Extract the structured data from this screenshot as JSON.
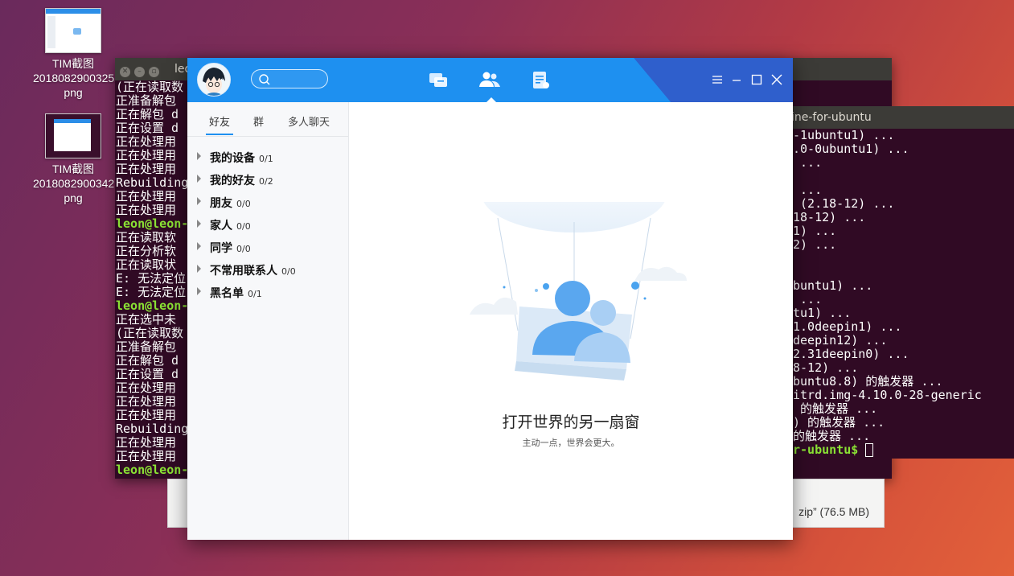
{
  "desktop": {
    "icons": [
      {
        "name": "TIM截图",
        "file": "20180829003252",
        "ext": "png"
      },
      {
        "name": "TIM截图",
        "file": "20180829003429",
        "ext": "png"
      }
    ]
  },
  "terminal_back": {
    "title": "leo",
    "lines": [
      {
        "t": "(正在读取数",
        "p": false
      },
      {
        "t": "正准备解包",
        "p": false
      },
      {
        "t": "正在解包 d",
        "p": false
      },
      {
        "t": "正在设置 d",
        "p": false
      },
      {
        "t": "正在处理用",
        "p": false
      },
      {
        "t": "正在处理用",
        "p": false
      },
      {
        "t": "正在处理用",
        "p": false
      },
      {
        "t": "Rebuilding",
        "p": false
      },
      {
        "t": "正在处理用",
        "p": false
      },
      {
        "t": "正在处理用",
        "p": false
      },
      {
        "t": "leon@leon-",
        "p": true
      },
      {
        "t": "正在读取软",
        "p": false
      },
      {
        "t": "正在分析软",
        "p": false
      },
      {
        "t": "正在读取状",
        "p": false
      },
      {
        "t": "E: 无法定位",
        "p": false
      },
      {
        "t": "E: 无法定位",
        "p": false
      },
      {
        "t": "leon@leon-",
        "p": true
      },
      {
        "t": "正在选中未",
        "p": false
      },
      {
        "t": "(正在读取数",
        "p": false
      },
      {
        "t": "正准备解包",
        "p": false
      },
      {
        "t": "正在解包 d",
        "p": false
      },
      {
        "t": "正在设置 d",
        "p": false
      },
      {
        "t": "正在处理用",
        "p": false
      },
      {
        "t": "正在处理用",
        "p": false
      },
      {
        "t": "正在处理用",
        "p": false
      },
      {
        "t": "Rebuilding",
        "p": false
      },
      {
        "t": "正在处理用",
        "p": false
      },
      {
        "t": "正在处理用",
        "p": false
      },
      {
        "t": "leon@leon-",
        "p": true
      }
    ]
  },
  "file_panel": {
    "text": "zip” (76.5 MB)"
  },
  "terminal_right": {
    "title": "ine-for-ubuntu",
    "lines": [
      "-1ubuntu1) ...",
      ".0-0ubuntu1) ...",
      " ...",
      "",
      " ...",
      " (2.18-12) ...",
      "18-12) ...",
      "1) ...",
      "2) ...",
      "",
      "",
      "buntu1) ...",
      " ...",
      "tu1) ...",
      "1.0deepin1) ...",
      "deepin12) ...",
      "2.31deepin0) ...",
      "8-12) ...",
      "buntu8.8) 的触发器 ...",
      "itrd.img-4.10.0-28-generic",
      " 的触发器 ...",
      ") 的触发器 ...",
      "的触发器 ..."
    ],
    "prompt_tail": "r-ubuntu$ "
  },
  "tim": {
    "tabs": [
      "好友",
      "群",
      "多人聊天"
    ],
    "groups": [
      {
        "name": "我的设备",
        "count": "0/1"
      },
      {
        "name": "我的好友",
        "count": "0/2"
      },
      {
        "name": "朋友",
        "count": "0/0"
      },
      {
        "name": "家人",
        "count": "0/0"
      },
      {
        "name": "同学",
        "count": "0/0"
      },
      {
        "name": "不常用联系人",
        "count": "0/0"
      },
      {
        "name": "黑名单",
        "count": "0/1"
      }
    ],
    "headline": "打开世界的另一扇窗",
    "subline": "主动一点，世界会更大。",
    "accent": "#1e90f0",
    "nav_icons": [
      "message-icon",
      "contacts-icon",
      "notes-icon"
    ],
    "active_nav": "contacts-icon"
  }
}
